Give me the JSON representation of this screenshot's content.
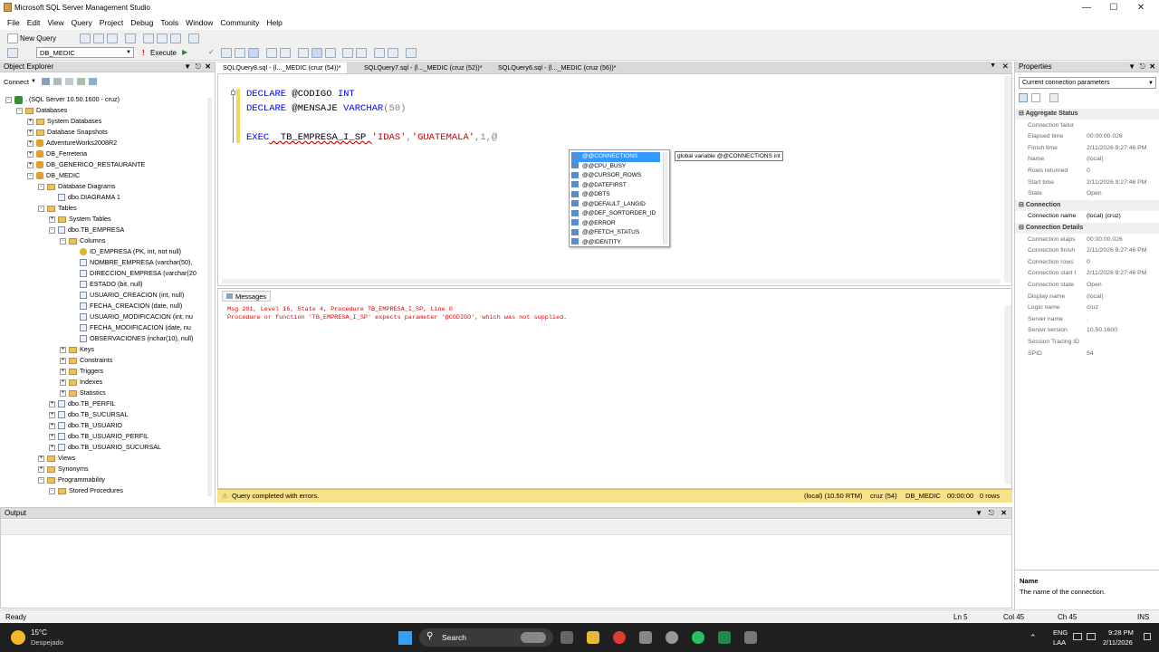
{
  "window": {
    "title": "Microsoft SQL Server Management Studio",
    "controls": [
      "minimize-icon",
      "maximize-icon",
      "close-icon"
    ]
  },
  "menu": [
    "File",
    "Edit",
    "View",
    "Query",
    "Project",
    "Debug",
    "Tools",
    "Window",
    "Community",
    "Help"
  ],
  "toolbar": {
    "new_query": "New Query",
    "database": "DB_MEDIC",
    "execute": "Execute"
  },
  "object_explorer": {
    "title": "Object Explorer",
    "connect": "Connect",
    "tree": [
      {
        "label": ". (SQL Server 10.50.1600 - cruz)",
        "level": 0,
        "icon": "server-icon",
        "exp": "-"
      },
      {
        "label": "Databases",
        "level": 1,
        "icon": "folder-icon",
        "exp": "-"
      },
      {
        "label": "System Databases",
        "level": 2,
        "icon": "folder-icon",
        "exp": "+"
      },
      {
        "label": "Database Snapshots",
        "level": 2,
        "icon": "folder-icon",
        "exp": "+"
      },
      {
        "label": "AdventureWorks2008R2",
        "level": 2,
        "icon": "database-icon",
        "exp": "+"
      },
      {
        "label": "DB_Ferreteria",
        "level": 2,
        "icon": "database-icon",
        "exp": "+"
      },
      {
        "label": "DB_GENERICO_RESTAURANTE",
        "level": 2,
        "icon": "database-icon",
        "exp": "+"
      },
      {
        "label": "DB_MEDIC",
        "level": 2,
        "icon": "database-icon",
        "exp": "-"
      },
      {
        "label": "Database Diagrams",
        "level": 3,
        "icon": "folder-icon",
        "exp": "-"
      },
      {
        "label": "dbo.DIAGRAMA 1",
        "level": 4,
        "icon": "column-icon",
        "exp": ""
      },
      {
        "label": "Tables",
        "level": 3,
        "icon": "folder-icon",
        "exp": "-"
      },
      {
        "label": "System Tables",
        "level": 4,
        "icon": "folder-icon",
        "exp": "+"
      },
      {
        "label": "dbo.TB_EMPRESA",
        "level": 4,
        "icon": "column-icon",
        "exp": "-"
      },
      {
        "label": "Columns",
        "level": 5,
        "icon": "folder-icon",
        "exp": "-"
      },
      {
        "label": "ID_EMPRESA (PK, int, not null)",
        "level": 6,
        "icon": "key-icon",
        "exp": ""
      },
      {
        "label": "NOMBRE_EMPRESA (varchar(50),",
        "level": 6,
        "icon": "column-icon",
        "exp": ""
      },
      {
        "label": "DIRECCION_EMPRESA (varchar(20",
        "level": 6,
        "icon": "column-icon",
        "exp": ""
      },
      {
        "label": "ESTADO (bit, null)",
        "level": 6,
        "icon": "column-icon",
        "exp": ""
      },
      {
        "label": "USUARIO_CREACION (int, null)",
        "level": 6,
        "icon": "column-icon",
        "exp": ""
      },
      {
        "label": "FECHA_CREACION (date, null)",
        "level": 6,
        "icon": "column-icon",
        "exp": ""
      },
      {
        "label": "USUARIO_MODIFICACION (int, nu",
        "level": 6,
        "icon": "column-icon",
        "exp": ""
      },
      {
        "label": "FECHA_MODIFICACION (date, nu",
        "level": 6,
        "icon": "column-icon",
        "exp": ""
      },
      {
        "label": "OBSERVACIONES (nchar(10), null)",
        "level": 6,
        "icon": "column-icon",
        "exp": ""
      },
      {
        "label": "Keys",
        "level": 5,
        "icon": "folder-icon",
        "exp": "+"
      },
      {
        "label": "Constraints",
        "level": 5,
        "icon": "folder-icon",
        "exp": "+"
      },
      {
        "label": "Triggers",
        "level": 5,
        "icon": "folder-icon",
        "exp": "+"
      },
      {
        "label": "Indexes",
        "level": 5,
        "icon": "folder-icon",
        "exp": "+"
      },
      {
        "label": "Statistics",
        "level": 5,
        "icon": "folder-icon",
        "exp": "+"
      },
      {
        "label": "dbo.TB_PERFIL",
        "level": 4,
        "icon": "column-icon",
        "exp": "+"
      },
      {
        "label": "dbo.TB_SUCURSAL",
        "level": 4,
        "icon": "column-icon",
        "exp": "+"
      },
      {
        "label": "dbo.TB_USUARIO",
        "level": 4,
        "icon": "column-icon",
        "exp": "+"
      },
      {
        "label": "dbo.TB_USUARIO_PERFIL",
        "level": 4,
        "icon": "column-icon",
        "exp": "+"
      },
      {
        "label": "dbo.TB_USUARIO_SUCURSAL",
        "level": 4,
        "icon": "column-icon",
        "exp": "+"
      },
      {
        "label": "Views",
        "level": 3,
        "icon": "folder-icon",
        "exp": "+"
      },
      {
        "label": "Synonyms",
        "level": 3,
        "icon": "folder-icon",
        "exp": "+"
      },
      {
        "label": "Programmability",
        "level": 3,
        "icon": "folder-icon",
        "exp": "-"
      },
      {
        "label": "Stored Procedures",
        "level": 4,
        "icon": "folder-icon",
        "exp": "-"
      }
    ]
  },
  "tabs": [
    "SQLQuery8.sql - (l..._MEDIC (cruz (54))*",
    "SQLQuery7.sql - (l..._MEDIC (cruz (52))*",
    "SQLQuery6.sql - (l..._MEDIC (cruz (56))*"
  ],
  "editor": {
    "line1_kw": "DECLARE",
    "line1_var": " @CODIGO ",
    "line1_type": "INT",
    "line2_kw": "DECLARE",
    "line2_var": " @MENSAJE ",
    "line2_type": "VARCHAR",
    "line2_rest": "(50)",
    "line3_kw": "EXEC",
    "line3_proc": "  TB_EMPRESA_I_SP ",
    "line3_s1": "'IDAS'",
    "line3_c1": ",",
    "line3_s2": "'GUATEMALA'",
    "line3_rest": ",1,@"
  },
  "autocomplete": {
    "items": [
      "@@CONNECTIONS",
      "@@CPU_BUSY",
      "@@CURSOR_ROWS",
      "@@DATEFIRST",
      "@@DBTS",
      "@@DEFAULT_LANGID",
      "@@DEF_SORTORDER_ID",
      "@@ERROR",
      "@@FETCH_STATUS",
      "@@IDENTITY"
    ],
    "tooltip": "global variable @@CONNECTIONS int"
  },
  "messages": {
    "tab": "Messages",
    "line1": "Msg 201, Level 16, State 4, Procedure TB_EMPRESA_I_SP, Line 0",
    "line2": "Procedure or function 'TB_EMPRESA_I_SP' expects parameter '@CODIGO', which was not supplied."
  },
  "query_status": {
    "text": "Query completed with errors.",
    "server": "(local) (10.50 RTM)",
    "user": "cruz (54)",
    "db": "DB_MEDIC",
    "time": "00:00:00",
    "rows": "0 rows"
  },
  "properties": {
    "title": "Properties",
    "selector": "Current connection parameters",
    "rows": [
      {
        "type": "cat",
        "label": "Aggregate Status"
      },
      {
        "k": "Connection failur",
        "v": ""
      },
      {
        "k": "Elapsed time",
        "v": "00:00:00.026"
      },
      {
        "k": "Finish time",
        "v": "2/11/2026 9:27:46 PM"
      },
      {
        "k": "Name",
        "v": "(local)"
      },
      {
        "k": "Rows returned",
        "v": "0"
      },
      {
        "k": "Start time",
        "v": "2/11/2026 9:27:46 PM"
      },
      {
        "k": "State",
        "v": "Open"
      },
      {
        "type": "cat",
        "label": "Connection"
      },
      {
        "k": "Connection name",
        "v": "(local) (cruz)",
        "bold": true
      },
      {
        "type": "cat",
        "label": "Connection Details"
      },
      {
        "k": "Connection elaps",
        "v": "00:00:00.026"
      },
      {
        "k": "Connection finish",
        "v": "2/11/2026 9:27:46 PM"
      },
      {
        "k": "Connection rows",
        "v": "0"
      },
      {
        "k": "Connection start t",
        "v": "2/11/2026 9:27:46 PM"
      },
      {
        "k": "Connection state",
        "v": "Open"
      },
      {
        "k": "Display name",
        "v": "(local)"
      },
      {
        "k": "Login name",
        "v": "cruz"
      },
      {
        "k": "Server name",
        "v": "."
      },
      {
        "k": "Server version",
        "v": "10.50.1600"
      },
      {
        "k": "Session Tracing ID",
        "v": ""
      },
      {
        "k": "SPID",
        "v": "54"
      }
    ],
    "desc_title": "Name",
    "desc_text": "The name of the connection."
  },
  "output": {
    "title": "Output"
  },
  "statusbar": {
    "ready": "Ready",
    "ln": "Ln 5",
    "col": "Col 45",
    "ch": "Ch 45",
    "ins": "INS"
  },
  "taskbar": {
    "weather_temp": "15°C",
    "weather_text": "Despejado",
    "search": "Search",
    "lang1": "ENG",
    "lang2": "LAA",
    "time": "9:28 PM",
    "date": "2/11/2026"
  }
}
